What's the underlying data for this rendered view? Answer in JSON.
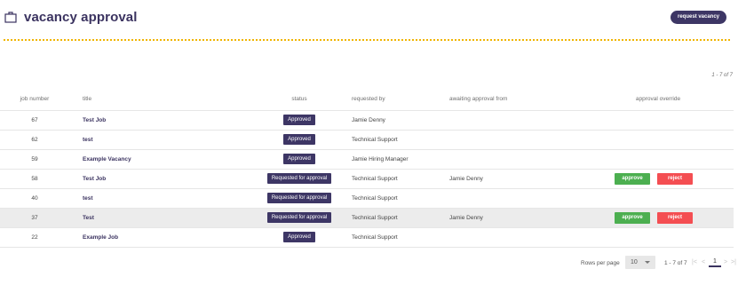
{
  "header": {
    "title": "vacancy approval",
    "title_icon": "briefcase-icon",
    "request_button": "request vacancy"
  },
  "pagination_top": {
    "count_text": "1 - 7 of 7"
  },
  "table": {
    "columns": {
      "job_number": "job number",
      "title": "title",
      "status": "status",
      "requested_by": "requested by",
      "awaiting": "awaiting approval from",
      "override": "approval override"
    },
    "rows": [
      {
        "job_number": "67",
        "title": "Test Job",
        "status": "Approved",
        "requested_by": "Jamie Denny",
        "awaiting": ""
      },
      {
        "job_number": "62",
        "title": "test",
        "status": "Approved",
        "requested_by": "Technical Support",
        "awaiting": ""
      },
      {
        "job_number": "59",
        "title": "Example Vacancy",
        "status": "Approved",
        "requested_by": "Jamie Hiring Manager",
        "awaiting": ""
      },
      {
        "job_number": "58",
        "title": "Test Job",
        "status": "Requested for approval",
        "requested_by": "Technical Support",
        "awaiting": "Jamie Denny",
        "approve": "approve",
        "reject": "reject"
      },
      {
        "job_number": "40",
        "title": "test",
        "status": "Requested for approval",
        "requested_by": "Technical Support",
        "awaiting": ""
      },
      {
        "job_number": "37",
        "title": "Test",
        "status": "Requested for approval",
        "requested_by": "Technical Support",
        "awaiting": "Jamie Denny",
        "approve": "approve",
        "reject": "reject"
      },
      {
        "job_number": "22",
        "title": "Example Job",
        "status": "Approved",
        "requested_by": "Technical Support",
        "awaiting": ""
      }
    ]
  },
  "pager": {
    "rows_per_page_label": "Rows per page",
    "rows_per_page_value": "10",
    "range": "1 - 7 of 7",
    "first": "|<",
    "prev": "<",
    "current_page": "1",
    "next": ">",
    "last": ">|"
  },
  "colors": {
    "brand": "#3d3665",
    "accent_dots": "#f0b400",
    "approve": "#4caf50",
    "reject": "#f44e52"
  }
}
